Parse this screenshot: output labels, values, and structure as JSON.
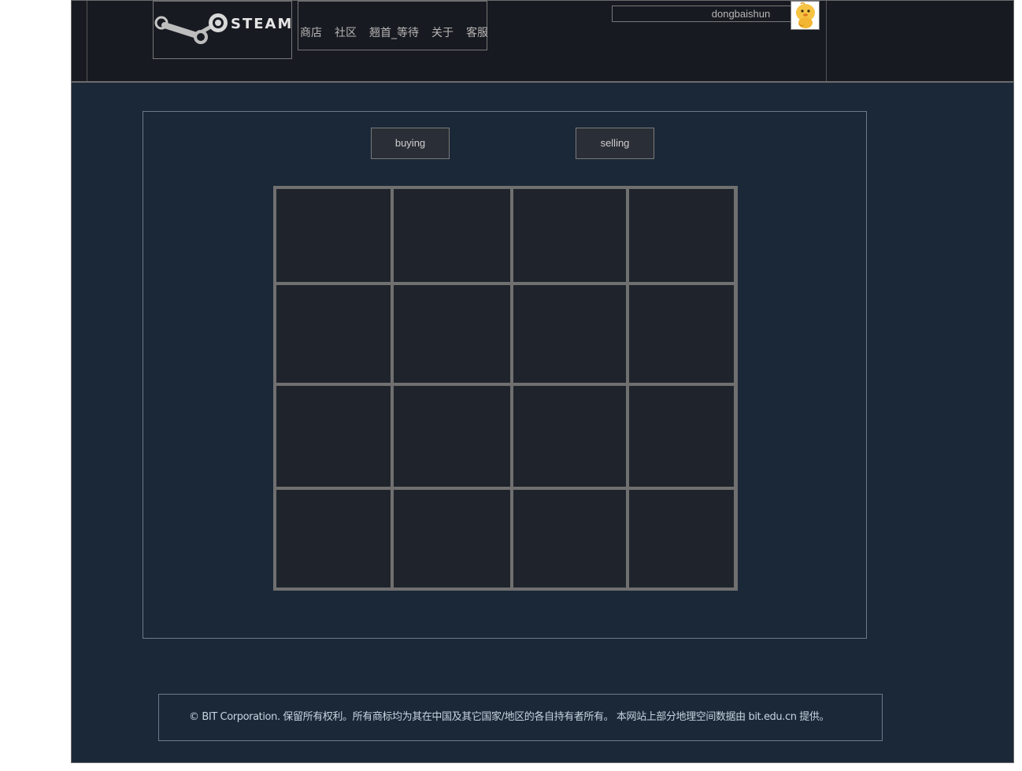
{
  "header": {
    "logo_text": "STEAM",
    "nav": [
      {
        "label": "商店"
      },
      {
        "label": "社区"
      },
      {
        "label": "翘首_等待"
      },
      {
        "label": "关于"
      },
      {
        "label": "客服"
      }
    ],
    "username": "dongbaishun",
    "avatar_icon": "yellow-chick-avatar-icon"
  },
  "main": {
    "buttons": {
      "buying": "buying",
      "selling": "selling"
    },
    "grid": {
      "rows": 4,
      "cols": 4
    }
  },
  "footer": {
    "text": "© BIT Corporation. 保留所有权利。所有商标均为其在中国及其它国家/地区的各自持有者所有。 本网站上部分地理空间数据由 bit.edu.cn 提供。"
  },
  "colors": {
    "background": "#1b2838",
    "header": "#171a21",
    "grid_line": "#707070",
    "cell": "#1f242c"
  }
}
